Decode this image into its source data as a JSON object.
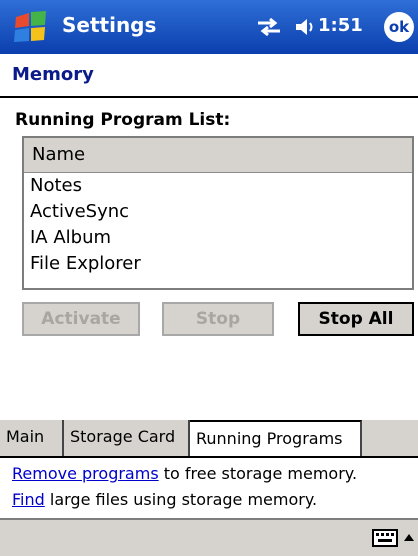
{
  "titlebar": {
    "app_title": "Settings",
    "clock": "1:51",
    "ok_label": "ok"
  },
  "page": {
    "title": "Memory",
    "section_label": "Running Program List:"
  },
  "list": {
    "column_header": "Name",
    "rows": [
      "Notes",
      "ActiveSync",
      "IA Album",
      "File Explorer"
    ]
  },
  "buttons": {
    "activate": "Activate",
    "stop": "Stop",
    "stop_all": "Stop All"
  },
  "tabs": [
    "Main",
    "Storage Card",
    "Running Programs"
  ],
  "info": {
    "line1_link": "Remove programs",
    "line1_text": " to free storage memory.",
    "line2_link": "Find",
    "line2_text": " large files using storage memory."
  },
  "icons": {
    "start": "windows-start-icon",
    "sync": "sync-arrows-icon",
    "volume": "speaker-volume-icon",
    "keyboard": "keyboard-icon",
    "sip_menu": "up-arrow-icon"
  },
  "colors": {
    "titlebar": "#0b3fae",
    "title_text": "#0b1b8a",
    "link": "#0000cc",
    "chrome": "#d6d3ce"
  }
}
